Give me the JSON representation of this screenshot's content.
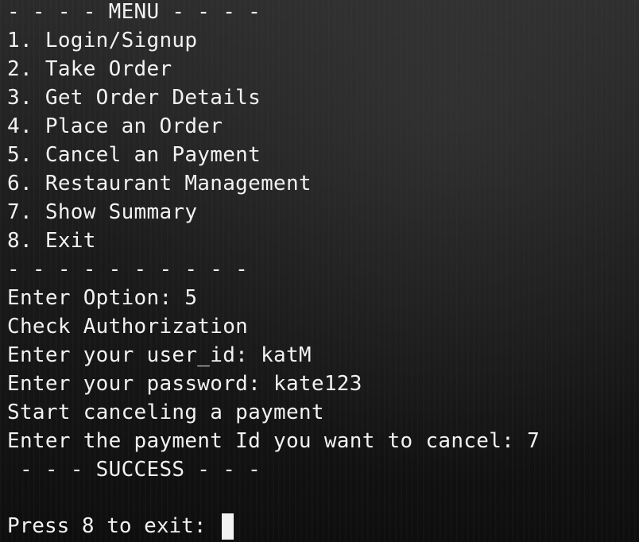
{
  "terminal": {
    "output_lines": [
      "- - - - MENU - - - -",
      "1. Login/Signup",
      "2. Take Order",
      "3. Get Order Details",
      "4. Place an Order",
      "5. Cancel an Payment",
      "6. Restaurant Management",
      "7. Show Summary",
      "8. Exit",
      "- - - - - - - - - -",
      "Enter Option: 5",
      "Check Authorization",
      "Enter your user_id: katM",
      "Enter your password: kate123",
      "Start canceling a payment",
      "Enter the payment Id you want to cancel: 7",
      " - - - SUCCESS - - -",
      ""
    ],
    "prompt": "Press 8 to exit: ",
    "colors": {
      "text": "#f2f2f2",
      "background": "#1b1b1b",
      "cursor": "#f2f2f2"
    }
  }
}
